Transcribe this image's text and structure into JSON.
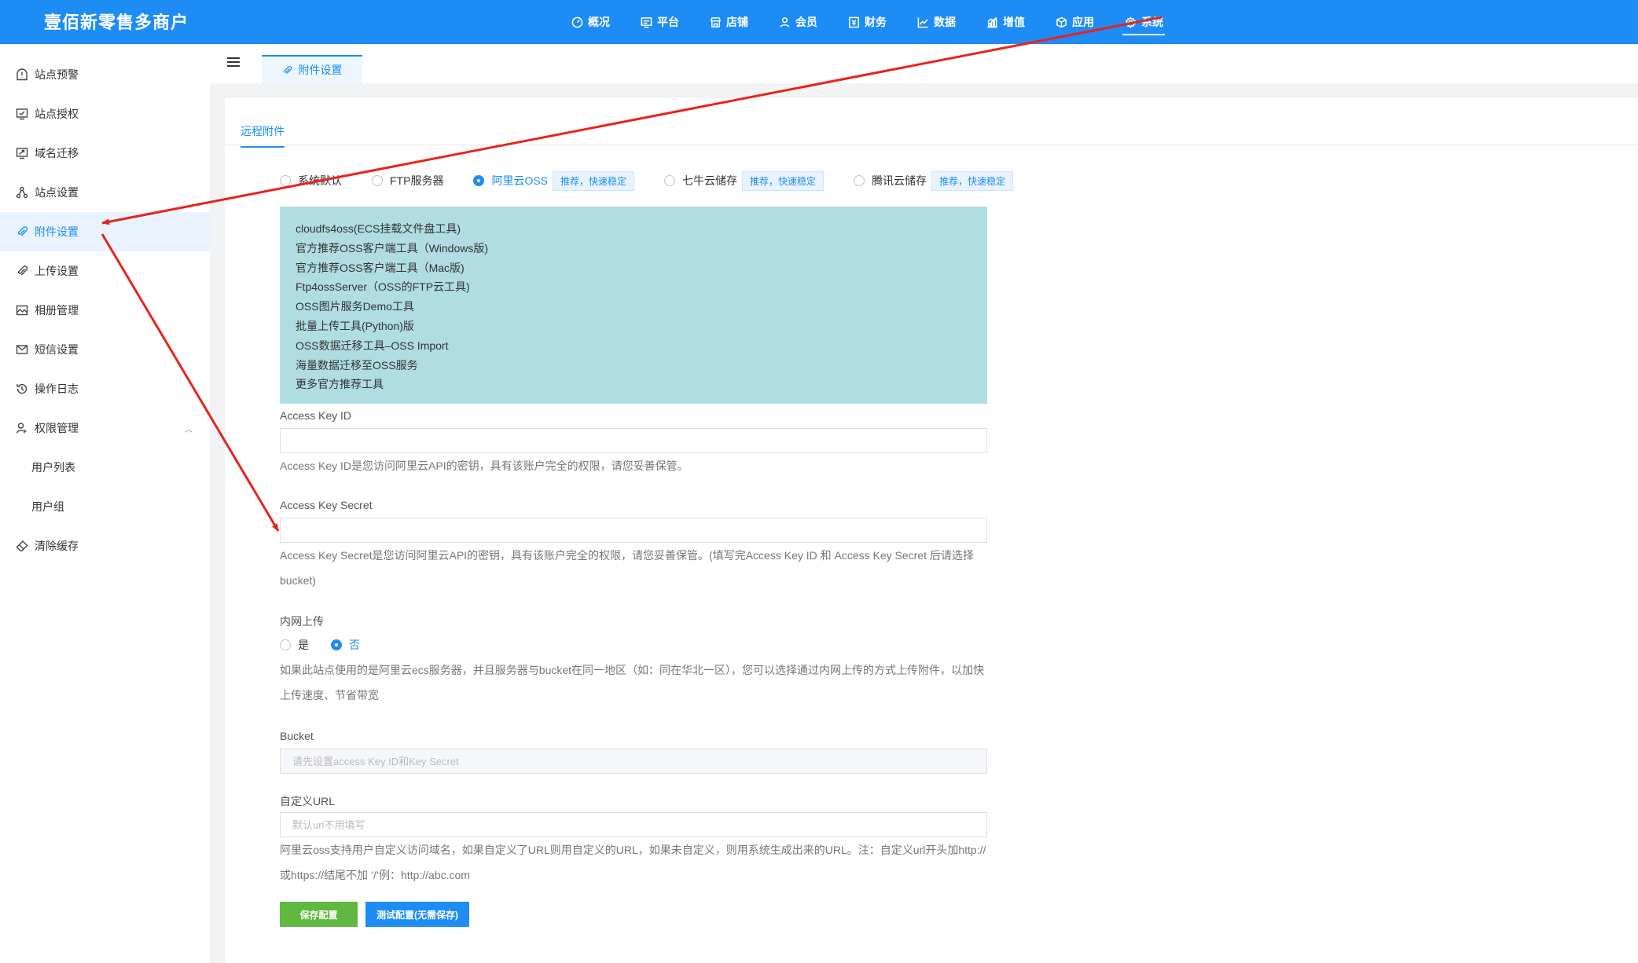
{
  "app": {
    "title": "壹佰新零售多商户"
  },
  "topnav": [
    {
      "label": "概况",
      "icon": "gauge-icon"
    },
    {
      "label": "平台",
      "icon": "monitor-icon"
    },
    {
      "label": "店铺",
      "icon": "store-icon"
    },
    {
      "label": "会员",
      "icon": "user-icon"
    },
    {
      "label": "财务",
      "icon": "finance-icon"
    },
    {
      "label": "数据",
      "icon": "line-chart-icon"
    },
    {
      "label": "增值",
      "icon": "growth-icon"
    },
    {
      "label": "应用",
      "icon": "cube-icon"
    },
    {
      "label": "系统",
      "icon": "gear-icon",
      "active": true
    }
  ],
  "sidebar": {
    "items": [
      {
        "label": "站点预警",
        "icon": "alert-icon"
      },
      {
        "label": "站点授权",
        "icon": "authorize-icon"
      },
      {
        "label": "域名迁移",
        "icon": "migrate-icon"
      },
      {
        "label": "站点设置",
        "icon": "sitemap-icon"
      },
      {
        "label": "附件设置",
        "icon": "paperclip-icon",
        "active": true
      },
      {
        "label": "上传设置",
        "icon": "paperclip-icon"
      },
      {
        "label": "相册管理",
        "icon": "image-icon"
      },
      {
        "label": "短信设置",
        "icon": "mail-icon"
      },
      {
        "label": "操作日志",
        "icon": "history-icon"
      },
      {
        "label": "权限管理",
        "icon": "user-key-icon",
        "expanded": true
      },
      {
        "label": "用户列表",
        "sub": true
      },
      {
        "label": "用户组",
        "sub": true
      },
      {
        "label": "清除缓存",
        "icon": "eraser-icon"
      }
    ]
  },
  "page_tab": {
    "label": "附件设置",
    "icon": "paperclip-icon"
  },
  "subtab": {
    "label": "远程附件"
  },
  "storage": {
    "options": [
      {
        "label": "系统默认",
        "checked": false
      },
      {
        "label": "FTP服务器",
        "checked": false
      },
      {
        "label": "阿里云OSS",
        "checked": true,
        "badge": "推荐，快速稳定"
      },
      {
        "label": "七牛云储存",
        "checked": false,
        "badge": "推荐，快速稳定"
      },
      {
        "label": "腾讯云储存",
        "checked": false,
        "badge": "推荐，快速稳定"
      }
    ]
  },
  "tools": [
    "cloudfs4oss(ECS挂载文件盘工具)",
    "官方推荐OSS客户端工具（Windows版)",
    "官方推荐OSS客户端工具（Mac版)",
    "Ftp4ossServer（OSS的FTP云工具)",
    "OSS图片服务Demo工具",
    "批量上传工具(Python)版",
    "OSS数据迁移工具–OSS Import",
    "海量数据迁移至OSS服务",
    "更多官方推荐工具"
  ],
  "form": {
    "access_key_id": {
      "label": "Access Key ID",
      "value": "",
      "help": "Access Key ID是您访问阿里云API的密钥，具有该账户完全的权限，请您妥善保管。"
    },
    "access_key_secret": {
      "label": "Access Key Secret",
      "value": "",
      "help": "Access Key Secret是您访问阿里云API的密钥，具有该账户完全的权限，请您妥善保管。(填写完Access Key ID 和 Access Key Secret 后请选择bucket)"
    },
    "intranet": {
      "label": "内网上传",
      "yes": "是",
      "no": "否",
      "selected": "否",
      "help": "如果此站点使用的是阿里云ecs服务器，并且服务器与bucket在同一地区（如：同在华北一区），您可以选择通过内网上传的方式上传附件，以加快上传速度、节省带宽"
    },
    "bucket": {
      "label": "Bucket",
      "placeholder": "请先设置access Key ID和Key Secret"
    },
    "custom_url": {
      "label": "自定义URL",
      "placeholder": "默认url不用填写",
      "help": "阿里云oss支持用户自定义访问域名，如果自定义了URL则用自定义的URL，如果未自定义，则用系统生成出来的URL。注：自定义url开头加http://或https://结尾不加 ‘/’例：http://abc.com"
    }
  },
  "buttons": {
    "save": "保存配置",
    "test": "测试配置(无需保存)"
  },
  "colors": {
    "primary": "#1e8cf5",
    "save_button": "#5fb840",
    "tools_box": "#afdde2",
    "annotation_arrow": "#e8241c"
  }
}
